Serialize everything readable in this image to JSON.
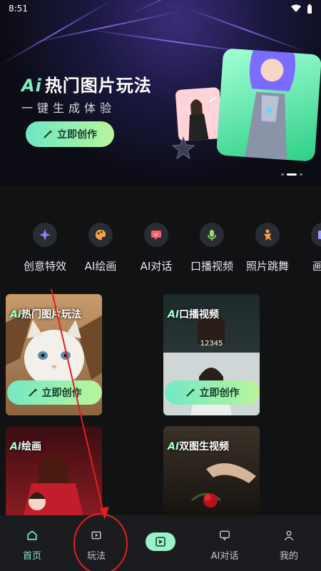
{
  "status_bar": {
    "time": "8:51"
  },
  "banner": {
    "title_ai": "Ai",
    "title": "热门图片玩法",
    "subtitle": "一键生成体验",
    "button_label": "立即创作"
  },
  "categories": [
    {
      "label": "创意特效",
      "icon": "sparkle-icon",
      "color": "#8a86ff"
    },
    {
      "label": "AI绘画",
      "icon": "palette-icon",
      "color": "#f0a247"
    },
    {
      "label": "AI对话",
      "icon": "ai-chat-icon",
      "color": "#ff5a6a"
    },
    {
      "label": "口播视频",
      "icon": "microphone-icon",
      "color": "#8fe06a"
    },
    {
      "label": "照片跳舞",
      "icon": "dance-icon",
      "color": "#ff9f4a"
    },
    {
      "label": "画廊",
      "icon": "gallery-icon",
      "color": "#9aa0ff"
    }
  ],
  "cards": [
    {
      "title_ai": "AI",
      "title": "热门图片玩法",
      "button_label": "立即创作"
    },
    {
      "title_ai": "AI",
      "title": "口播视频",
      "button_label": "立即创作",
      "counter": "12345"
    },
    {
      "title_ai": "AI",
      "title": "绘画"
    },
    {
      "title_ai": "AI",
      "title": "双图生视频"
    }
  ],
  "tabbar": {
    "home": "首页",
    "play": "玩法",
    "ai_chat": "AI对话",
    "mine": "我的"
  },
  "colors": {
    "accent": "#7fe9c0",
    "annotation": "#e02020"
  }
}
